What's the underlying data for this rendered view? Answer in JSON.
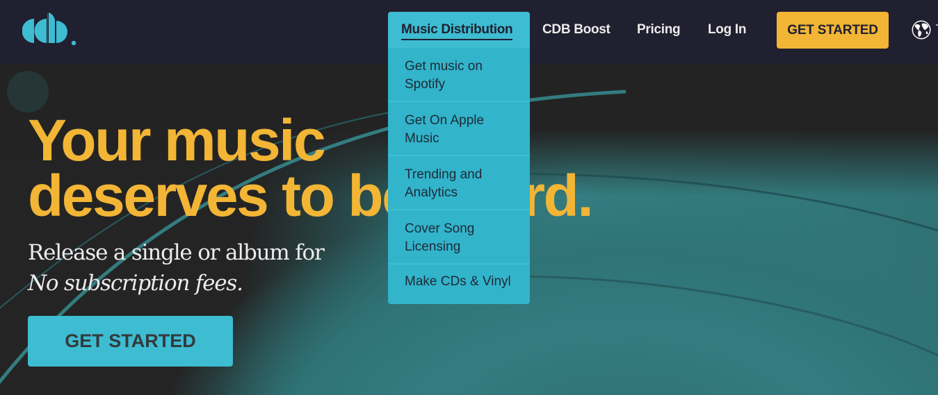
{
  "brand": {
    "logo_icon": "cdb-logo",
    "accent": "#3dbcd2",
    "yellow": "#f2b535",
    "navy": "#202030"
  },
  "nav": {
    "items": [
      {
        "label": "Music Distribution"
      },
      {
        "label": "CDB Boost"
      },
      {
        "label": "Pricing"
      },
      {
        "label": "Log In"
      }
    ],
    "cta_label": "GET STARTED",
    "language_icon": "globe-icon"
  },
  "dropdown": {
    "title": "Music Distribution",
    "items": [
      {
        "label": "Get music on Spotify"
      },
      {
        "label": "Get On Apple Music"
      },
      {
        "label": "Trending and Analytics"
      },
      {
        "label": "Cover Song Licensing"
      },
      {
        "label": "Make CDs & Vinyl"
      }
    ]
  },
  "hero": {
    "headline_line1": "Your music",
    "headline_line2": "deserves to be heard.",
    "subtitle": "Release a single or album for",
    "subtitle_em": "No subscription fees.",
    "cta_label": "GET STARTED"
  }
}
